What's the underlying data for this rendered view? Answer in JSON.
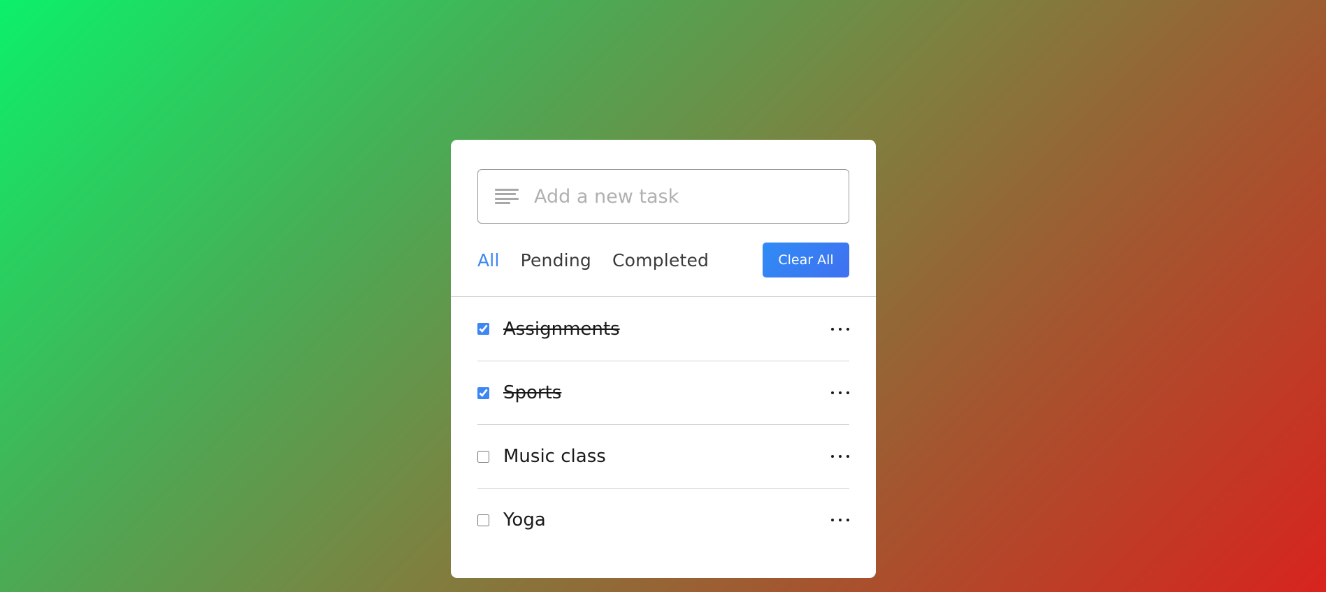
{
  "input": {
    "placeholder": "Add a new task",
    "value": "",
    "icon": "lines-icon"
  },
  "filters": [
    {
      "label": "All",
      "active": true
    },
    {
      "label": "Pending",
      "active": false
    },
    {
      "label": "Completed",
      "active": false
    }
  ],
  "clear_button": {
    "label": "Clear All"
  },
  "tasks": [
    {
      "label": "Assignments",
      "checked": true
    },
    {
      "label": "Sports",
      "checked": true
    },
    {
      "label": "Music class",
      "checked": false
    },
    {
      "label": "Yoga",
      "checked": false
    }
  ],
  "colors": {
    "accent": "#3c87f4",
    "background_gradient": [
      "#0cf06a",
      "#7f7f3f",
      "#d8231e"
    ]
  }
}
